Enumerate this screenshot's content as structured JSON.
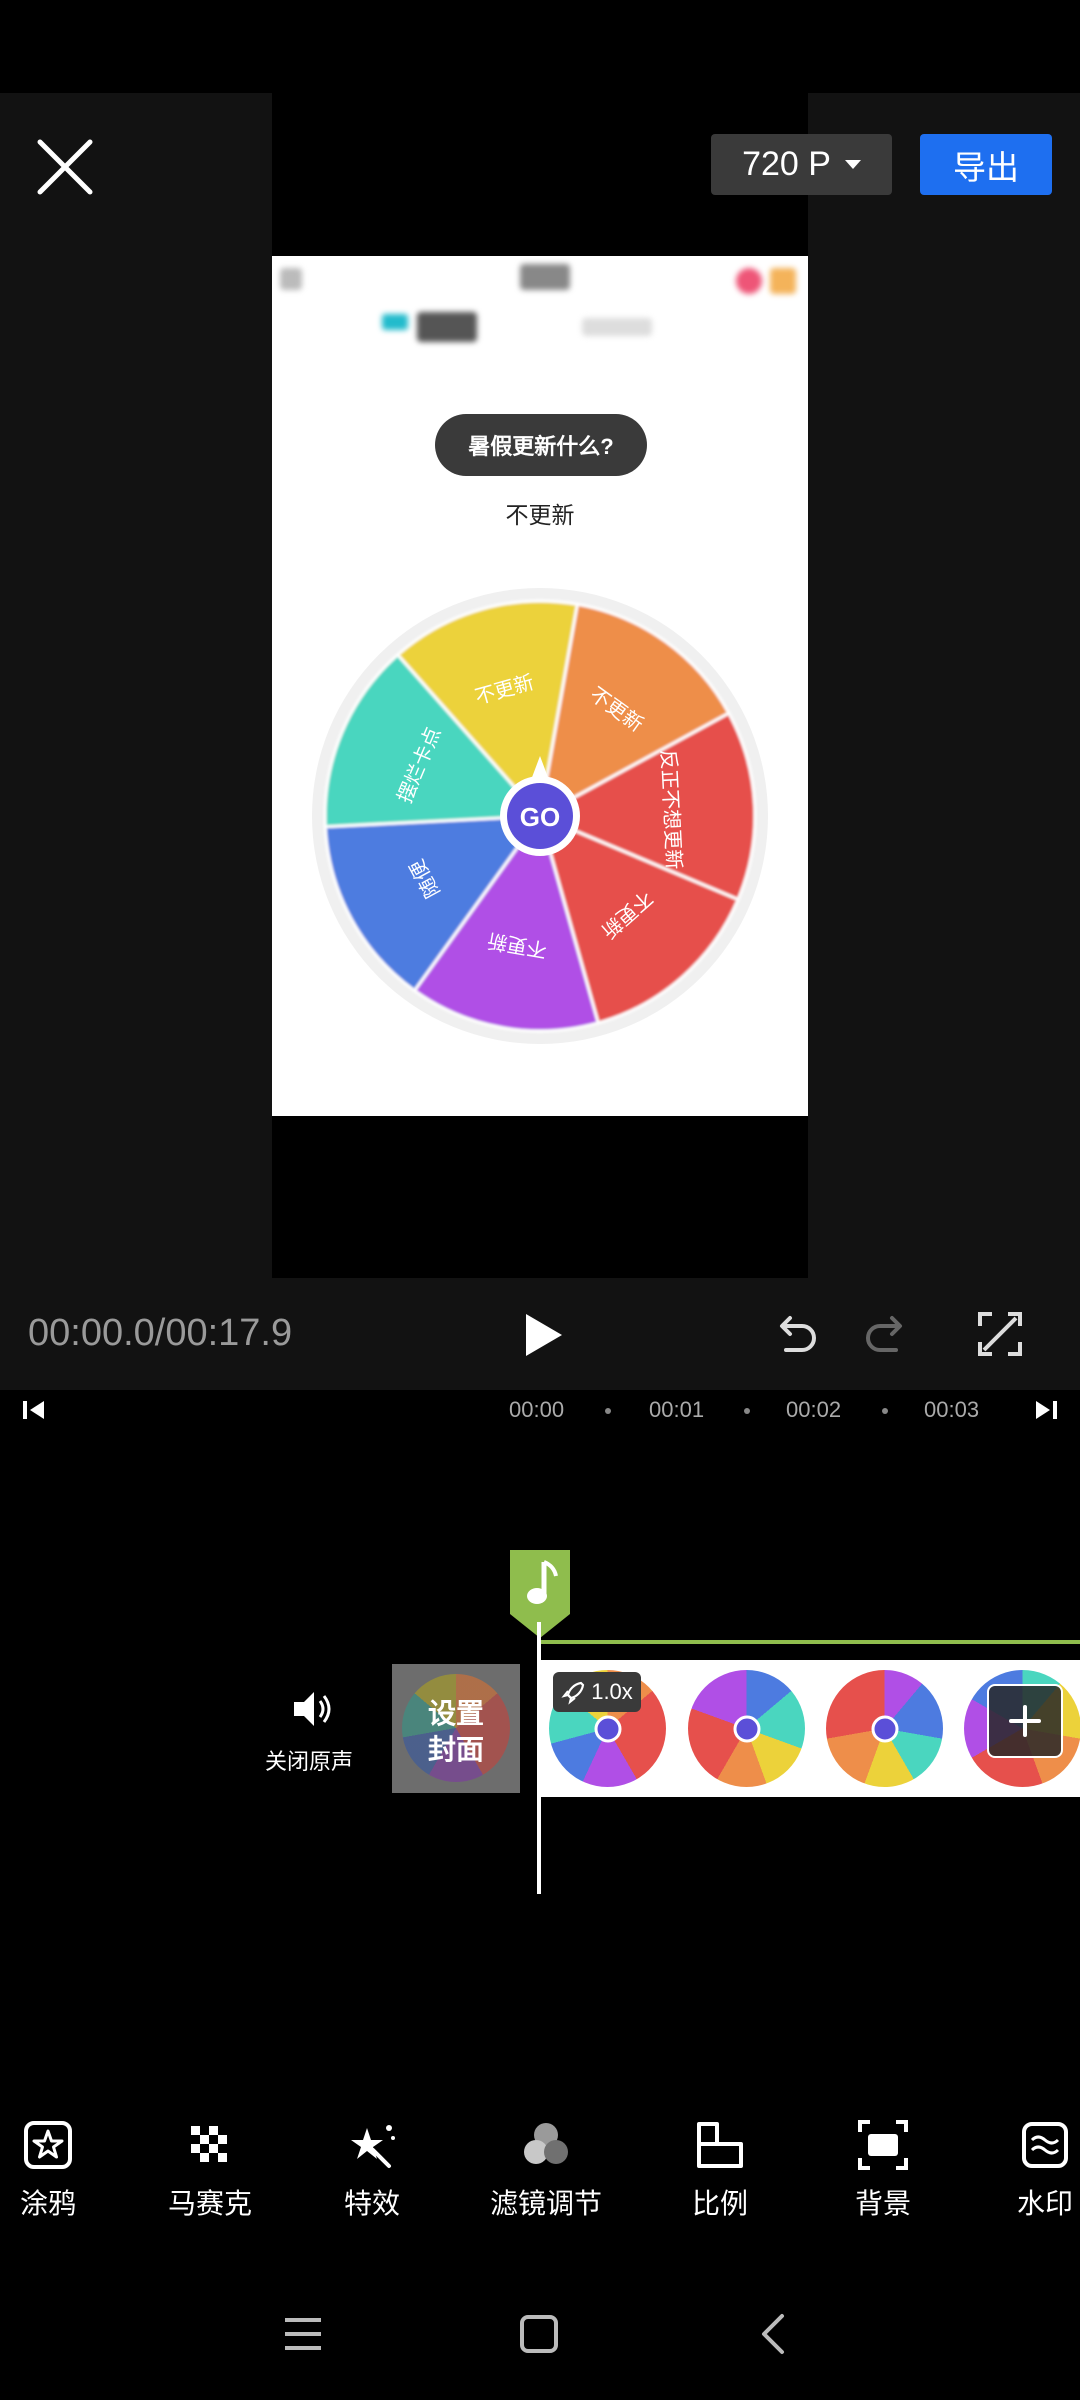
{
  "header": {
    "resolution_label": "720 P",
    "export_label": "导出"
  },
  "preview": {
    "question": "暑假更新什么?",
    "answer": "不更新",
    "wheel": {
      "center_label": "GO",
      "segments": [
        {
          "label": "不更新",
          "color": "#ee8e4a"
        },
        {
          "label": "反正不想更新",
          "color": "#e6504c"
        },
        {
          "label": "不更新",
          "color": "#e6504c"
        },
        {
          "label": "不更新",
          "color": "#b04fe6"
        },
        {
          "label": "随便",
          "color": "#4d7be0"
        },
        {
          "label": "摆烂卡点",
          "color": "#4ad6bf"
        },
        {
          "label": "不更新",
          "color": "#ecd23a"
        }
      ]
    }
  },
  "playback": {
    "timecode": "00:00.0/00:17.9"
  },
  "timeline": {
    "ruler": [
      "00:00",
      "00:01",
      "00:02",
      "00:03"
    ],
    "mute_label": "关闭原声",
    "cover_label_line1": "设置",
    "cover_label_line2": "封面",
    "speed": "1.0x"
  },
  "toolbar": [
    {
      "label": "涂鸦",
      "icon": "doodle-icon"
    },
    {
      "label": "马赛克",
      "icon": "mosaic-icon"
    },
    {
      "label": "特效",
      "icon": "effects-icon"
    },
    {
      "label": "滤镜调节",
      "icon": "filter-icon"
    },
    {
      "label": "比例",
      "icon": "ratio-icon"
    },
    {
      "label": "背景",
      "icon": "background-icon"
    },
    {
      "label": "水印",
      "icon": "watermark-icon"
    }
  ],
  "colors": {
    "accent": "#1e6ff0",
    "audio_marker": "#8fbd4d"
  }
}
